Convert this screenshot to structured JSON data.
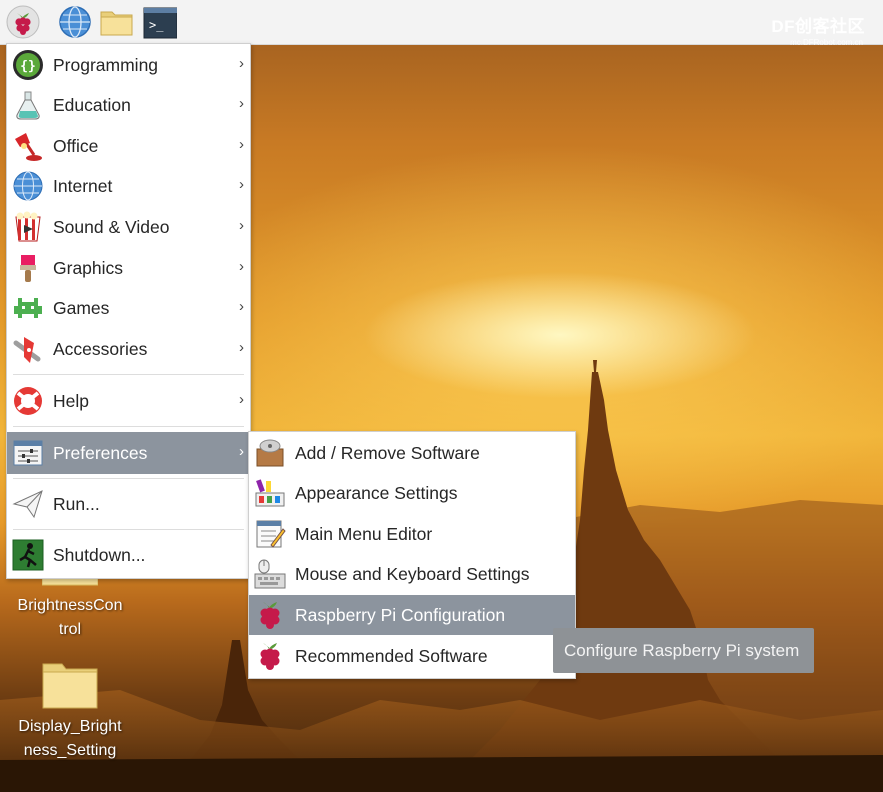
{
  "brand": {
    "text": "DF创客社区",
    "sub": "mc.DFRobot.com.cn"
  },
  "taskbar": {
    "items": [
      "raspberry-menu-icon",
      "web-browser-icon",
      "file-manager-icon",
      "terminal-icon"
    ],
    "terminal_glyph": ">_"
  },
  "main_menu": {
    "items": [
      {
        "label": "Programming",
        "icon": "programming-icon",
        "has_submenu": true
      },
      {
        "label": "Education",
        "icon": "education-icon",
        "has_submenu": true
      },
      {
        "label": "Office",
        "icon": "office-icon",
        "has_submenu": true
      },
      {
        "label": "Internet",
        "icon": "internet-icon",
        "has_submenu": true
      },
      {
        "label": "Sound & Video",
        "icon": "sound-video-icon",
        "has_submenu": true
      },
      {
        "label": "Graphics",
        "icon": "graphics-icon",
        "has_submenu": true
      },
      {
        "label": "Games",
        "icon": "games-icon",
        "has_submenu": true
      },
      {
        "label": "Accessories",
        "icon": "accessories-icon",
        "has_submenu": true
      },
      {
        "label": "Help",
        "icon": "help-icon",
        "has_submenu": true
      },
      {
        "label": "Preferences",
        "icon": "preferences-icon",
        "has_submenu": true,
        "selected": true
      },
      {
        "label": "Run...",
        "icon": "run-icon",
        "has_submenu": false
      },
      {
        "label": "Shutdown...",
        "icon": "shutdown-icon",
        "has_submenu": false
      }
    ],
    "arrow": "›"
  },
  "preferences_submenu": {
    "items": [
      {
        "label": "Add / Remove Software",
        "icon": "add-remove-software-icon"
      },
      {
        "label": "Appearance Settings",
        "icon": "appearance-settings-icon"
      },
      {
        "label": "Main Menu Editor",
        "icon": "main-menu-editor-icon"
      },
      {
        "label": "Mouse and Keyboard Settings",
        "icon": "mouse-keyboard-icon"
      },
      {
        "label": "Raspberry Pi Configuration",
        "icon": "raspberry-pi-config-icon",
        "selected": true
      },
      {
        "label": "Recommended Software",
        "icon": "recommended-software-icon"
      }
    ]
  },
  "tooltip": {
    "text": "Configure Raspberry Pi system"
  },
  "desktop_icons": [
    {
      "label_line1": "BrightnessCon",
      "label_line2": "trol",
      "icon": "folder-icon"
    },
    {
      "label_line1": "Display_Bright",
      "label_line2": "ness_Setting",
      "icon": "folder-icon"
    }
  ],
  "colors": {
    "selected_bg": "#8c949e",
    "menu_bg": "#ffffff",
    "tooltip_bg": "#8e9296",
    "raspberry_red": "#c51a4a",
    "folder_yellow": "#f7e19a"
  }
}
